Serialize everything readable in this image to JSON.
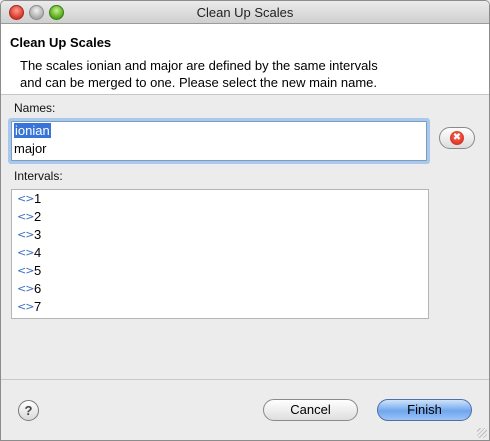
{
  "window": {
    "title": "Clean Up Scales"
  },
  "header": {
    "title": "Clean Up Scales",
    "message_line1": "The scales ionian and major are defined by the same intervals",
    "message_line2": "and can be merged to one. Please select the new main name."
  },
  "names": {
    "label": "Names:",
    "items": [
      "ionian",
      "major"
    ],
    "selected_index": 0
  },
  "remove_button": {
    "icon": "remove-icon",
    "glyph": "✖"
  },
  "intervals": {
    "label": "Intervals:",
    "icon": "interval-arrows-icon",
    "icon_glyph": "<>",
    "items": [
      "1",
      "2",
      "3",
      "4",
      "5",
      "6",
      "7"
    ]
  },
  "footer": {
    "help_glyph": "?",
    "cancel_label": "Cancel",
    "finish_label": "Finish"
  },
  "colors": {
    "selection": "#3875d7",
    "default_button": "#6fa6ee"
  }
}
